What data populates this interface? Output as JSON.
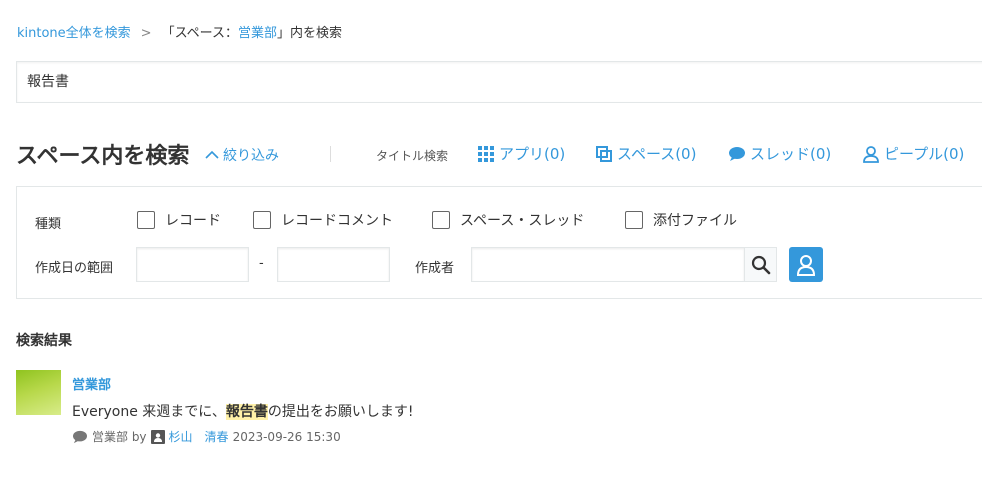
{
  "breadcrumb": {
    "root_link": "kintone全体を検索",
    "separator": ">",
    "current_prefix": "「スペース：",
    "current_space": "営業部",
    "current_suffix": "」内を検索"
  },
  "search": {
    "value": "報告書"
  },
  "header": {
    "title": "スペース内を検索",
    "narrow_label": "絞り込み",
    "title_search_label": "タイトル検索",
    "tabs": [
      {
        "label": "アプリ(0)",
        "icon": "grid-icon"
      },
      {
        "label": "スペース(0)",
        "icon": "space-icon"
      },
      {
        "label": "スレッド(0)",
        "icon": "speech-bubble-icon"
      },
      {
        "label": "ピープル(0)",
        "icon": "person-icon"
      }
    ]
  },
  "filters": {
    "type_label": "種類",
    "types": [
      "レコード",
      "レコードコメント",
      "スペース・スレッド",
      "添付ファイル"
    ],
    "date_range_label": "作成日の範囲",
    "date_separator": "-",
    "creator_label": "作成者"
  },
  "results": {
    "heading": "検索結果",
    "items": [
      {
        "title": "営業部",
        "body_before": "Everyone 来週までに、",
        "body_highlight": "報告書",
        "body_after": "の提出をお願いします!",
        "meta_space": "営業部 by",
        "meta_user": "杉山　清春",
        "meta_date": "2023-09-26 15:30"
      }
    ]
  },
  "colors": {
    "accent": "#3498db",
    "highlight": "#fff1a8"
  }
}
